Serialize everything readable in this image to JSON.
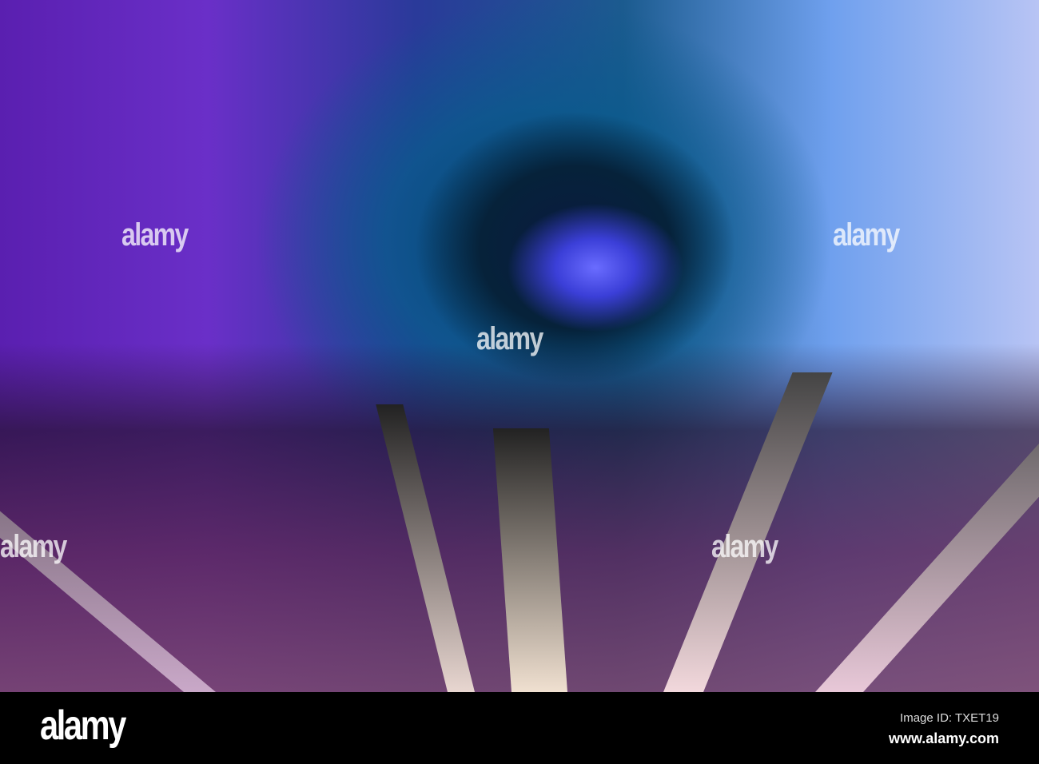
{
  "photo": {
    "subject": "tunnel-motion-blur",
    "watermark": "alamy",
    "colors": {
      "left": "#6a2fc8",
      "center": "#0a6a9a",
      "right": "#b8c4f4",
      "tunnel_end": "#4a4cf0"
    }
  },
  "footer": {
    "logo": "alamy",
    "image_id": "Image ID: TXET19",
    "url": "www.alamy.com"
  }
}
